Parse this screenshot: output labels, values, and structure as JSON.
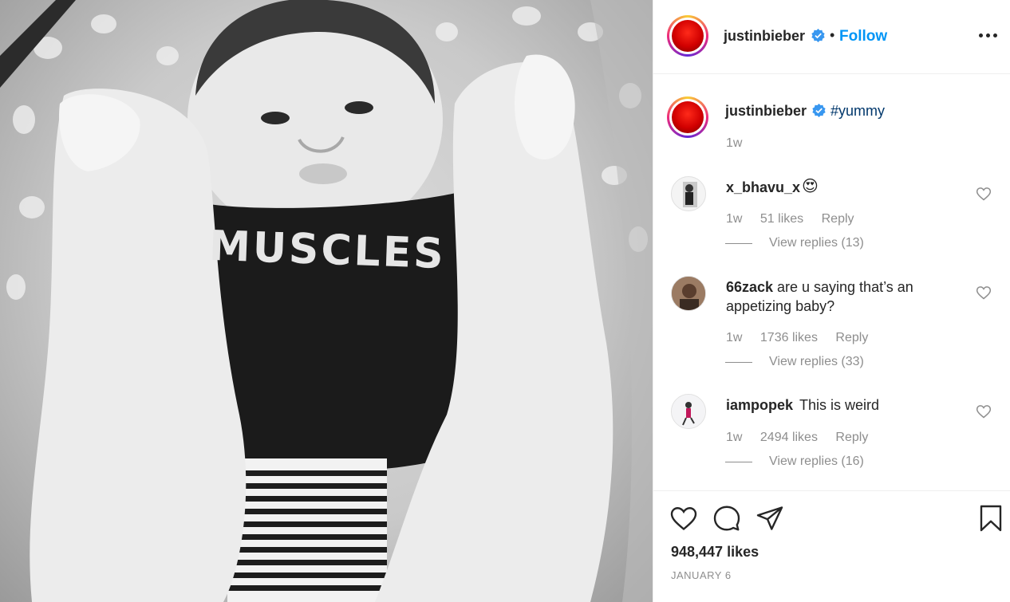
{
  "post": {
    "image_alt": "Black and white photo of a chubby baby holding up legs",
    "shirt_text": "MUSCLES",
    "author": "justinbieber",
    "verified": true,
    "follow_label": "Follow",
    "separator": "•",
    "caption_hashtag": "#yummy",
    "caption_time": "1w",
    "likes": "948,447 likes",
    "date": "JANUARY 6"
  },
  "comments": [
    {
      "user": "x_bhavu_x",
      "text": "😍",
      "time": "1w",
      "likes": "51 likes",
      "reply": "Reply",
      "view_replies": "View replies (13)"
    },
    {
      "user": "66zack",
      "text": "are u saying that’s an appetizing baby?",
      "time": "1w",
      "likes": "1736 likes",
      "reply": "Reply",
      "view_replies": "View replies (33)"
    },
    {
      "user": "iampopek",
      "text": "This is weird",
      "time": "1w",
      "likes": "2494 likes",
      "reply": "Reply",
      "view_replies": "View replies (16)"
    }
  ],
  "icons": {
    "header": [
      "avatar",
      "verified-icon",
      "more-options-icon"
    ],
    "actions": [
      "heart-icon",
      "comment-icon",
      "share-icon",
      "bookmark-icon"
    ]
  },
  "colors": {
    "follow": "#0095f6",
    "hashtag": "#00376b",
    "verified": "#3897f0",
    "muted": "#8e8e8e",
    "text": "#262626"
  }
}
